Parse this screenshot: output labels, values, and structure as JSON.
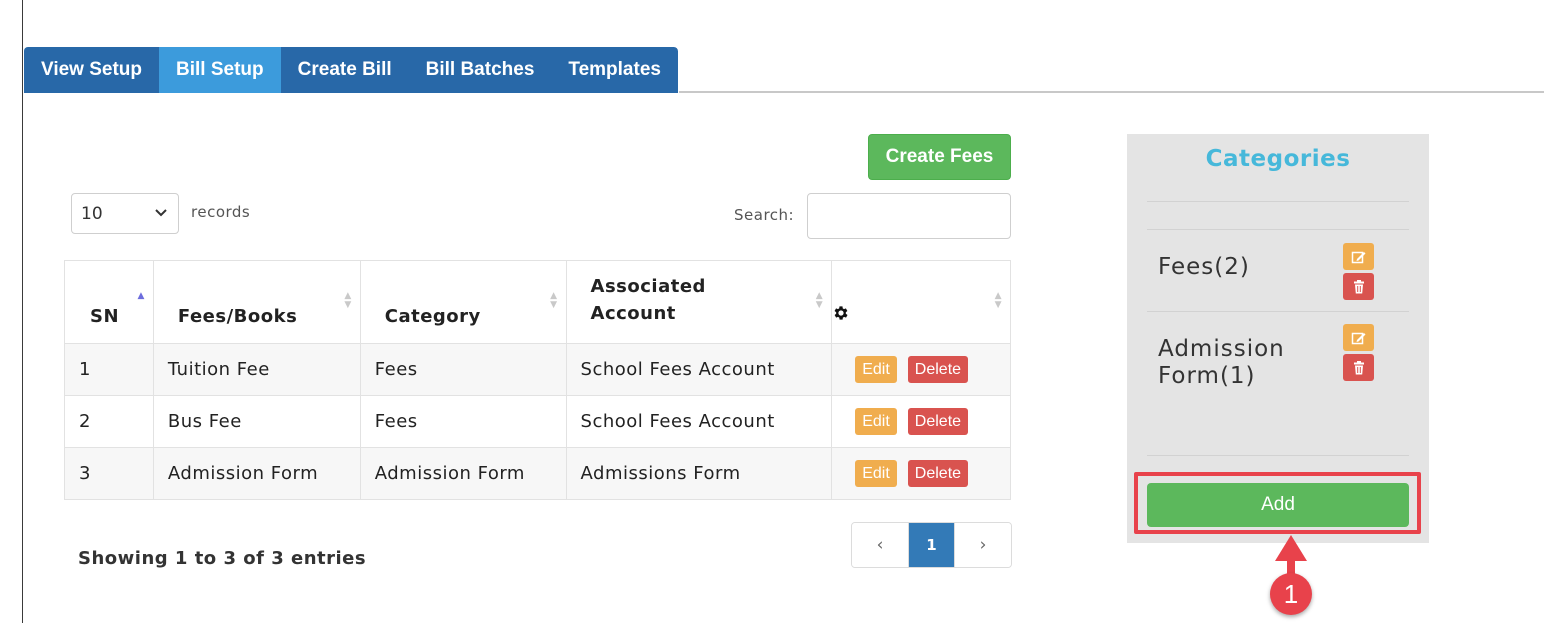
{
  "tabs": [
    {
      "label": "View Setup",
      "active": false
    },
    {
      "label": "Bill Setup",
      "active": true
    },
    {
      "label": "Create Bill",
      "active": false
    },
    {
      "label": "Bill Batches",
      "active": false
    },
    {
      "label": "Templates",
      "active": false
    }
  ],
  "toolbar": {
    "create_fees_label": "Create Fees"
  },
  "records": {
    "selected": "10",
    "label": "records"
  },
  "search": {
    "label": "Search:",
    "value": ""
  },
  "table": {
    "headers": {
      "sn": "SN",
      "fees_books": "Fees/Books",
      "category": "Category",
      "account_line1": "Associated",
      "account_line2": "Account",
      "actions_icon": "gear-icon"
    },
    "rows": [
      {
        "sn": "1",
        "fees_books": "Tuition Fee",
        "category": "Fees",
        "account": "School Fees Account",
        "edit": "Edit",
        "delete": "Delete"
      },
      {
        "sn": "2",
        "fees_books": "Bus Fee",
        "category": "Fees",
        "account": "School Fees Account",
        "edit": "Edit",
        "delete": "Delete"
      },
      {
        "sn": "3",
        "fees_books": "Admission Form",
        "category": "Admission Form",
        "account": "Admissions Form",
        "edit": "Edit",
        "delete": "Delete"
      }
    ]
  },
  "footer": {
    "showing": "Showing 1 to 3 of 3 entries"
  },
  "pagination": {
    "prev": "‹",
    "current": "1",
    "next": "›"
  },
  "categories": {
    "title": "Categories",
    "items": [
      {
        "name": "Fees(2)"
      },
      {
        "name_line1": "Admission",
        "name_line2": "Form(1)"
      }
    ],
    "add_label": "Add"
  },
  "annotation": {
    "callout": "1"
  },
  "colors": {
    "tab": "#2868a8",
    "tab_active": "#3c9bdc",
    "green": "#5cb85c",
    "orange": "#f0ad4e",
    "red": "#d9534f",
    "highlight": "#e8424b",
    "title": "#46b8da"
  }
}
